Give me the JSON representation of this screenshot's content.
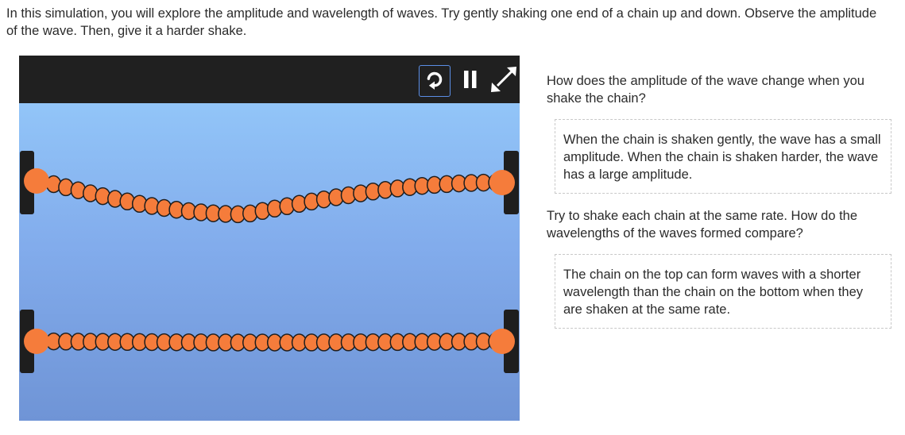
{
  "intro": "In this simulation, you will explore the amplitude and wavelength of waves. Try gently shaking one end of a chain up and down. Observe the amplitude of the wave. Then, give it a harder shake.",
  "simulation": {
    "toolbar": {
      "replay_icon": "replay-icon",
      "pause_icon": "pause-icon",
      "expand_icon": "expand-icon"
    },
    "colors": {
      "toolbar": "#202020",
      "sky_top": "#92c5f8",
      "sky_bottom": "#6f94d6",
      "chain": "#f57c3b",
      "chain_outline": "#1e1e1e",
      "handle": "#1e1e1e"
    }
  },
  "questions": [
    {
      "prompt": "How does the amplitude of the wave change when you shake the chain?",
      "answer": "When the chain is shaken gently, the wave has a small amplitude. When the chain is shaken harder, the wave has a large amplitude."
    },
    {
      "prompt": "Try to shake each chain at the same rate. How do the wavelengths of the waves formed compare?",
      "answer": "The chain on the top can form waves with a shorter wavelength than the chain on the bottom when they are shaken at the same rate."
    }
  ]
}
